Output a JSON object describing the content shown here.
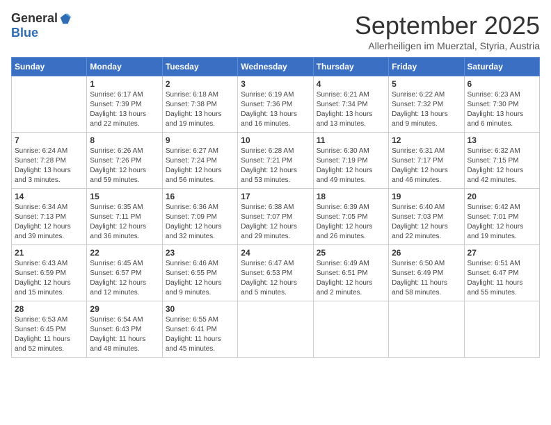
{
  "header": {
    "logo_general": "General",
    "logo_blue": "Blue",
    "month": "September 2025",
    "location": "Allerheiligen im Muerztal, Styria, Austria"
  },
  "days_of_week": [
    "Sunday",
    "Monday",
    "Tuesday",
    "Wednesday",
    "Thursday",
    "Friday",
    "Saturday"
  ],
  "weeks": [
    [
      {
        "day": "",
        "info": ""
      },
      {
        "day": "1",
        "info": "Sunrise: 6:17 AM\nSunset: 7:39 PM\nDaylight: 13 hours\nand 22 minutes."
      },
      {
        "day": "2",
        "info": "Sunrise: 6:18 AM\nSunset: 7:38 PM\nDaylight: 13 hours\nand 19 minutes."
      },
      {
        "day": "3",
        "info": "Sunrise: 6:19 AM\nSunset: 7:36 PM\nDaylight: 13 hours\nand 16 minutes."
      },
      {
        "day": "4",
        "info": "Sunrise: 6:21 AM\nSunset: 7:34 PM\nDaylight: 13 hours\nand 13 minutes."
      },
      {
        "day": "5",
        "info": "Sunrise: 6:22 AM\nSunset: 7:32 PM\nDaylight: 13 hours\nand 9 minutes."
      },
      {
        "day": "6",
        "info": "Sunrise: 6:23 AM\nSunset: 7:30 PM\nDaylight: 13 hours\nand 6 minutes."
      }
    ],
    [
      {
        "day": "7",
        "info": "Sunrise: 6:24 AM\nSunset: 7:28 PM\nDaylight: 13 hours\nand 3 minutes."
      },
      {
        "day": "8",
        "info": "Sunrise: 6:26 AM\nSunset: 7:26 PM\nDaylight: 12 hours\nand 59 minutes."
      },
      {
        "day": "9",
        "info": "Sunrise: 6:27 AM\nSunset: 7:24 PM\nDaylight: 12 hours\nand 56 minutes."
      },
      {
        "day": "10",
        "info": "Sunrise: 6:28 AM\nSunset: 7:21 PM\nDaylight: 12 hours\nand 53 minutes."
      },
      {
        "day": "11",
        "info": "Sunrise: 6:30 AM\nSunset: 7:19 PM\nDaylight: 12 hours\nand 49 minutes."
      },
      {
        "day": "12",
        "info": "Sunrise: 6:31 AM\nSunset: 7:17 PM\nDaylight: 12 hours\nand 46 minutes."
      },
      {
        "day": "13",
        "info": "Sunrise: 6:32 AM\nSunset: 7:15 PM\nDaylight: 12 hours\nand 42 minutes."
      }
    ],
    [
      {
        "day": "14",
        "info": "Sunrise: 6:34 AM\nSunset: 7:13 PM\nDaylight: 12 hours\nand 39 minutes."
      },
      {
        "day": "15",
        "info": "Sunrise: 6:35 AM\nSunset: 7:11 PM\nDaylight: 12 hours\nand 36 minutes."
      },
      {
        "day": "16",
        "info": "Sunrise: 6:36 AM\nSunset: 7:09 PM\nDaylight: 12 hours\nand 32 minutes."
      },
      {
        "day": "17",
        "info": "Sunrise: 6:38 AM\nSunset: 7:07 PM\nDaylight: 12 hours\nand 29 minutes."
      },
      {
        "day": "18",
        "info": "Sunrise: 6:39 AM\nSunset: 7:05 PM\nDaylight: 12 hours\nand 26 minutes."
      },
      {
        "day": "19",
        "info": "Sunrise: 6:40 AM\nSunset: 7:03 PM\nDaylight: 12 hours\nand 22 minutes."
      },
      {
        "day": "20",
        "info": "Sunrise: 6:42 AM\nSunset: 7:01 PM\nDaylight: 12 hours\nand 19 minutes."
      }
    ],
    [
      {
        "day": "21",
        "info": "Sunrise: 6:43 AM\nSunset: 6:59 PM\nDaylight: 12 hours\nand 15 minutes."
      },
      {
        "day": "22",
        "info": "Sunrise: 6:45 AM\nSunset: 6:57 PM\nDaylight: 12 hours\nand 12 minutes."
      },
      {
        "day": "23",
        "info": "Sunrise: 6:46 AM\nSunset: 6:55 PM\nDaylight: 12 hours\nand 9 minutes."
      },
      {
        "day": "24",
        "info": "Sunrise: 6:47 AM\nSunset: 6:53 PM\nDaylight: 12 hours\nand 5 minutes."
      },
      {
        "day": "25",
        "info": "Sunrise: 6:49 AM\nSunset: 6:51 PM\nDaylight: 12 hours\nand 2 minutes."
      },
      {
        "day": "26",
        "info": "Sunrise: 6:50 AM\nSunset: 6:49 PM\nDaylight: 11 hours\nand 58 minutes."
      },
      {
        "day": "27",
        "info": "Sunrise: 6:51 AM\nSunset: 6:47 PM\nDaylight: 11 hours\nand 55 minutes."
      }
    ],
    [
      {
        "day": "28",
        "info": "Sunrise: 6:53 AM\nSunset: 6:45 PM\nDaylight: 11 hours\nand 52 minutes."
      },
      {
        "day": "29",
        "info": "Sunrise: 6:54 AM\nSunset: 6:43 PM\nDaylight: 11 hours\nand 48 minutes."
      },
      {
        "day": "30",
        "info": "Sunrise: 6:55 AM\nSunset: 6:41 PM\nDaylight: 11 hours\nand 45 minutes."
      },
      {
        "day": "",
        "info": ""
      },
      {
        "day": "",
        "info": ""
      },
      {
        "day": "",
        "info": ""
      },
      {
        "day": "",
        "info": ""
      }
    ]
  ]
}
